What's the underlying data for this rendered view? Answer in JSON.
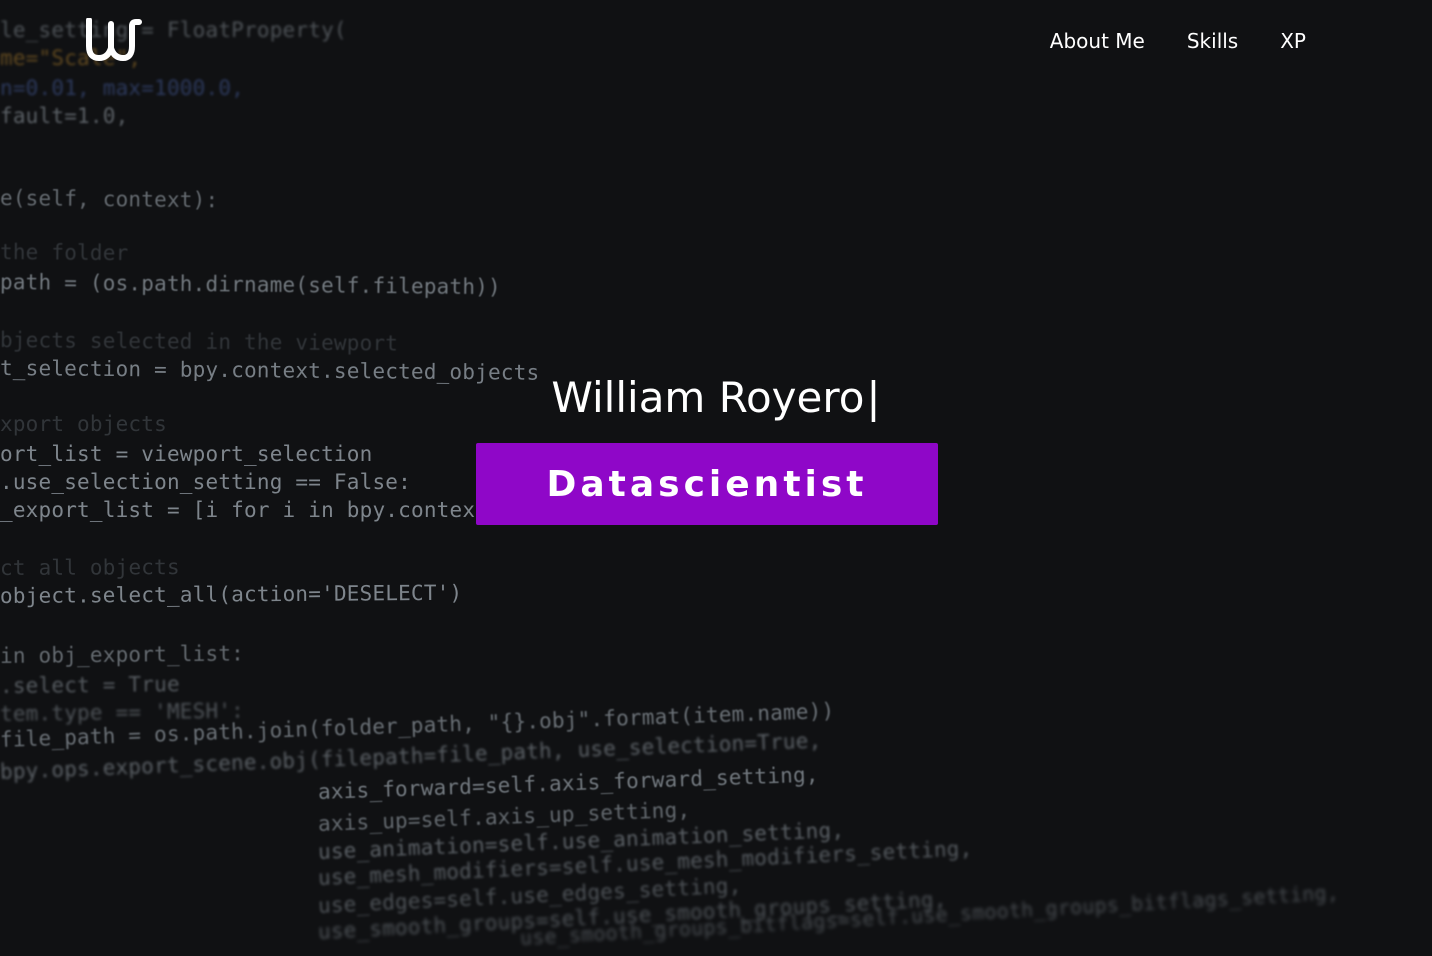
{
  "header": {
    "logo_alt": "W",
    "nav": [
      {
        "label": "About Me"
      },
      {
        "label": "Skills"
      },
      {
        "label": "XP"
      }
    ]
  },
  "hero": {
    "name": "William Royero",
    "cursor": "|",
    "role": "Datascientist"
  },
  "colors": {
    "accent": "#8f07c8",
    "background": "#111214",
    "text": "#ffffff"
  },
  "background_code": [
    "le_setting = FloatProperty(",
    "me=\"Scale\",",
    "n=0.01, max=1000.0,",
    "fault=1.0,",
    "e(self, context):",
    "the folder",
    "path = (os.path.dirname(self.filepath))",
    "bjects selected in the viewport",
    "t_selection = bpy.context.selected_objects",
    "xport objects",
    "ort_list = viewport_selection",
    ".use_selection_setting == False:",
    "_export_list = [i for i in bpy.context",
    "ct all objects",
    "object.select_all(action='DESELECT')",
    "in obj_export_list:",
    ".select = True",
    "tem.type == 'MESH':",
    "file_path = os.path.join(folder_path, \"{}.obj\".format(item.name))",
    "bpy.ops.export_scene.obj(filepath=file_path, use_selection=True,",
    "axis_forward=self.axis_forward_setting,",
    "axis_up=self.axis_up_setting,",
    "use_animation=self.use_animation_setting,",
    "use_mesh_modifiers=self.use_mesh_modifiers_setting,",
    "use_edges=self.use_edges_setting,",
    "use_smooth_groups=self.use_smooth_groups_setting,",
    "use_smooth_groups_bitflags=self.use_smooth_groups_bitflags_setting,"
  ]
}
